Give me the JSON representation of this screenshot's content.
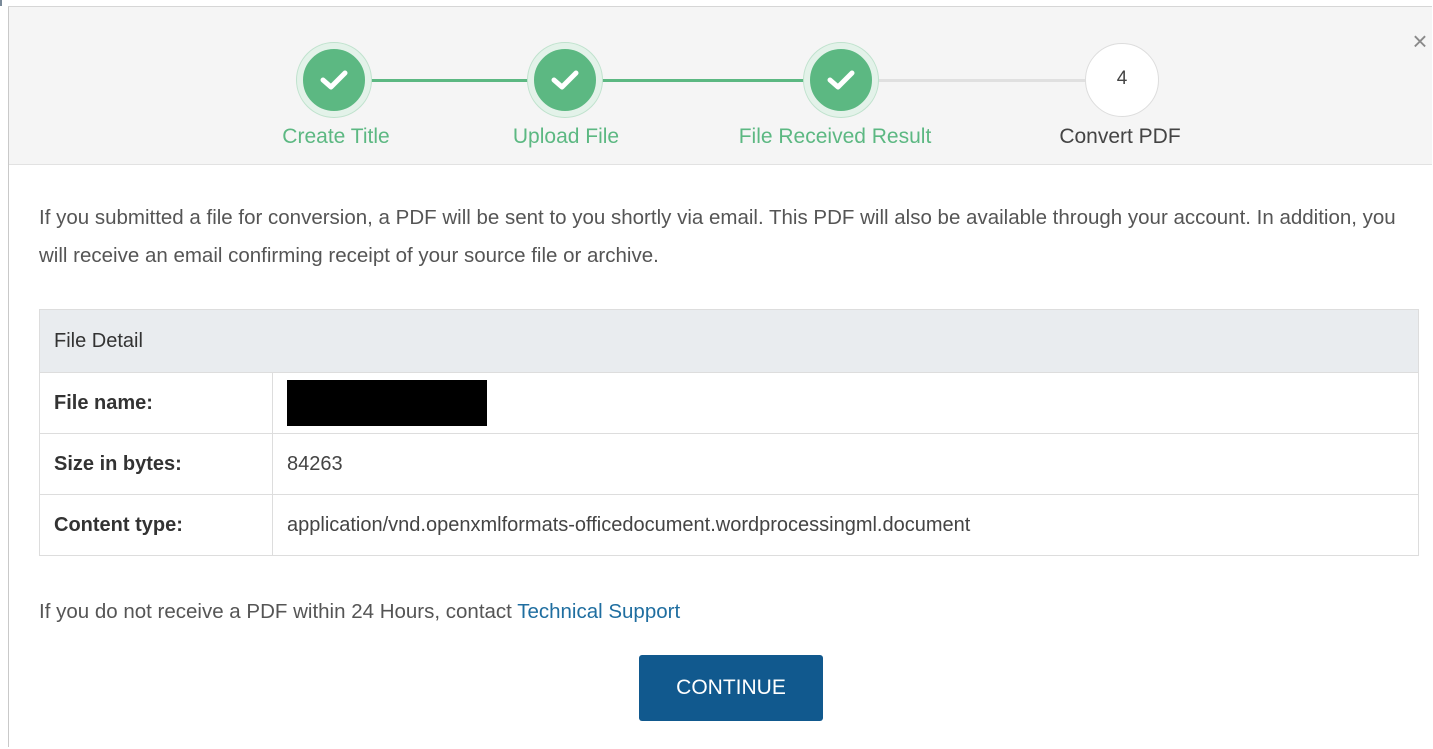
{
  "dialog": {
    "close_label": "×"
  },
  "steps": [
    {
      "label": "Create Title",
      "status": "done"
    },
    {
      "label": "Upload File",
      "status": "done"
    },
    {
      "label": "File Received Result",
      "status": "done"
    },
    {
      "label": "Convert PDF",
      "status": "pending",
      "number": "4"
    }
  ],
  "intro_text": "If you submitted a file for conversion, a PDF will be sent to you shortly via email. This PDF will also be available through your account. In addition, you will receive an email confirming receipt of your source file or archive.",
  "detail_table": {
    "header": "File Detail",
    "rows": [
      {
        "key": "File name:",
        "value": ""
      },
      {
        "key": "Size in bytes:",
        "value": "84263"
      },
      {
        "key": "Content type:",
        "value": "application/vnd.openxmlformats-officedocument.wordprocessingml.document"
      }
    ]
  },
  "footer": {
    "note": "If you do not receive a PDF within 24 Hours, contact ",
    "link": "Technical Support"
  },
  "continue_label": "CONTINUE",
  "colors": {
    "done": "#5cb882",
    "primary_button": "#11598e",
    "link": "#1f6ea0"
  },
  "icons": {
    "done_step": "check-icon",
    "close": "close-icon"
  }
}
